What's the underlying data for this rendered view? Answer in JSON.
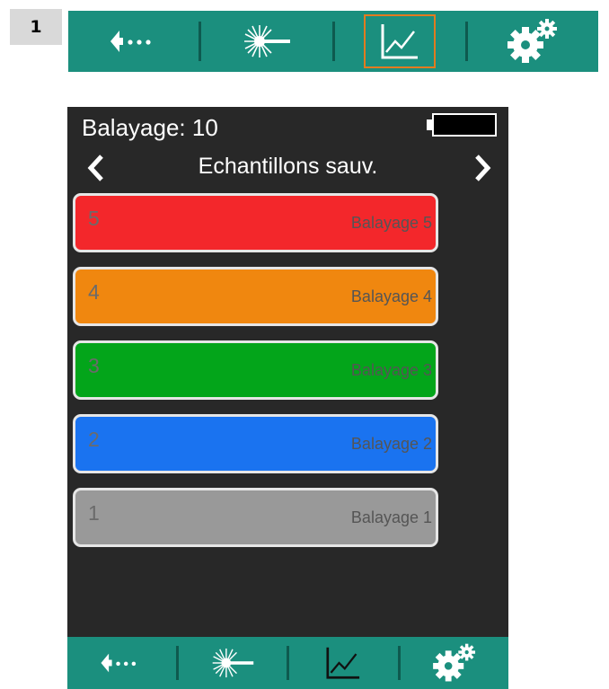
{
  "step": {
    "number": "1"
  },
  "toolbar": {
    "accent_color": "#1b8f7e",
    "items": [
      {
        "icon": "back-arrow-dots-icon"
      },
      {
        "icon": "laser-burst-icon"
      },
      {
        "icon": "line-chart-icon",
        "active": true
      },
      {
        "icon": "gears-icon"
      }
    ]
  },
  "screen": {
    "status": "Balayage: 10",
    "battery_icon": "battery-icon",
    "nav": {
      "title": "Echantillons sauv.",
      "prev_icon": "chevron-left-icon",
      "next_icon": "chevron-right-icon"
    },
    "scans": [
      {
        "number": "5",
        "label": "Balayage 5",
        "color": "#f3272b"
      },
      {
        "number": "4",
        "label": "Balayage 4",
        "color": "#f0870f"
      },
      {
        "number": "3",
        "label": "Balayage 3",
        "color": "#03a51a"
      },
      {
        "number": "2",
        "label": "Balayage 2",
        "color": "#1a73f0"
      },
      {
        "number": "1",
        "label": "Balayage 1",
        "color": "#999999"
      }
    ]
  }
}
